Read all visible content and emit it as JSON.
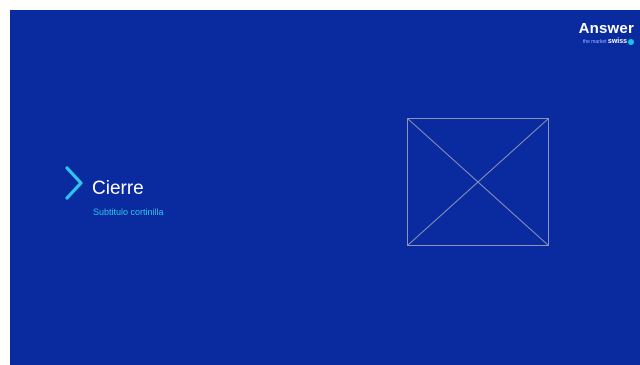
{
  "slide": {
    "background_color": "#0a2aa0",
    "title": "Cierre",
    "subtitle": "Subtitulo cortinilla",
    "chevron_icon": "chevron-right-icon",
    "image_placeholder_icon": "image-placeholder-icon"
  },
  "logo": {
    "wordmark": "Answer",
    "tagline": "the market",
    "brand": "swiss"
  },
  "colors": {
    "accent": "#2ec4ee",
    "text": "#ffffff",
    "placeholder_stroke": "#8a93b8"
  }
}
